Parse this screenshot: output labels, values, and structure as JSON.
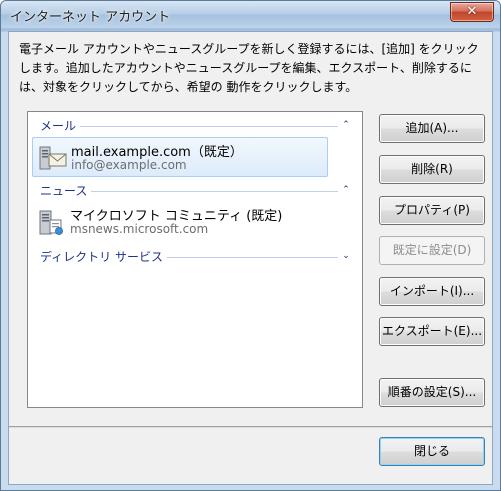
{
  "window": {
    "title": "インターネット アカウント",
    "close_glyph": "✕"
  },
  "description": "電子メール アカウントやニュースグループを新しく登録するには、[追加] をクリックします。追加したアカウントやニュースグループを編集、エクスポート、削除するには、対象をクリックしてから、希望の 動作をクリックします。",
  "groups": {
    "mail": {
      "label": "メール",
      "chevron": "⌃",
      "items": [
        {
          "name": "mail.example.com（既定）",
          "sub": "info@example.com",
          "selected": true,
          "icon": "mail-account-icon"
        }
      ]
    },
    "news": {
      "label": "ニュース",
      "chevron": "⌃",
      "items": [
        {
          "name": "マイクロソフト コミュニティ (既定)",
          "sub": "msnews.microsoft.com",
          "selected": false,
          "icon": "news-server-icon"
        }
      ]
    },
    "directory": {
      "label": "ディレクトリ サービス",
      "chevron": "⌄"
    }
  },
  "buttons": {
    "add": "追加(A)...",
    "delete": "削除(R)",
    "properties": "プロパティ(P)",
    "set_default": "既定に設定(D)",
    "import": "インポート(I)...",
    "export": "エクスポート(E)...",
    "order": "順番の設定(S)...",
    "close": "閉じる"
  },
  "colors": {
    "group_header": "#1e3287",
    "selection_border": "#a9cdf3",
    "close_button": "#c0462e"
  }
}
